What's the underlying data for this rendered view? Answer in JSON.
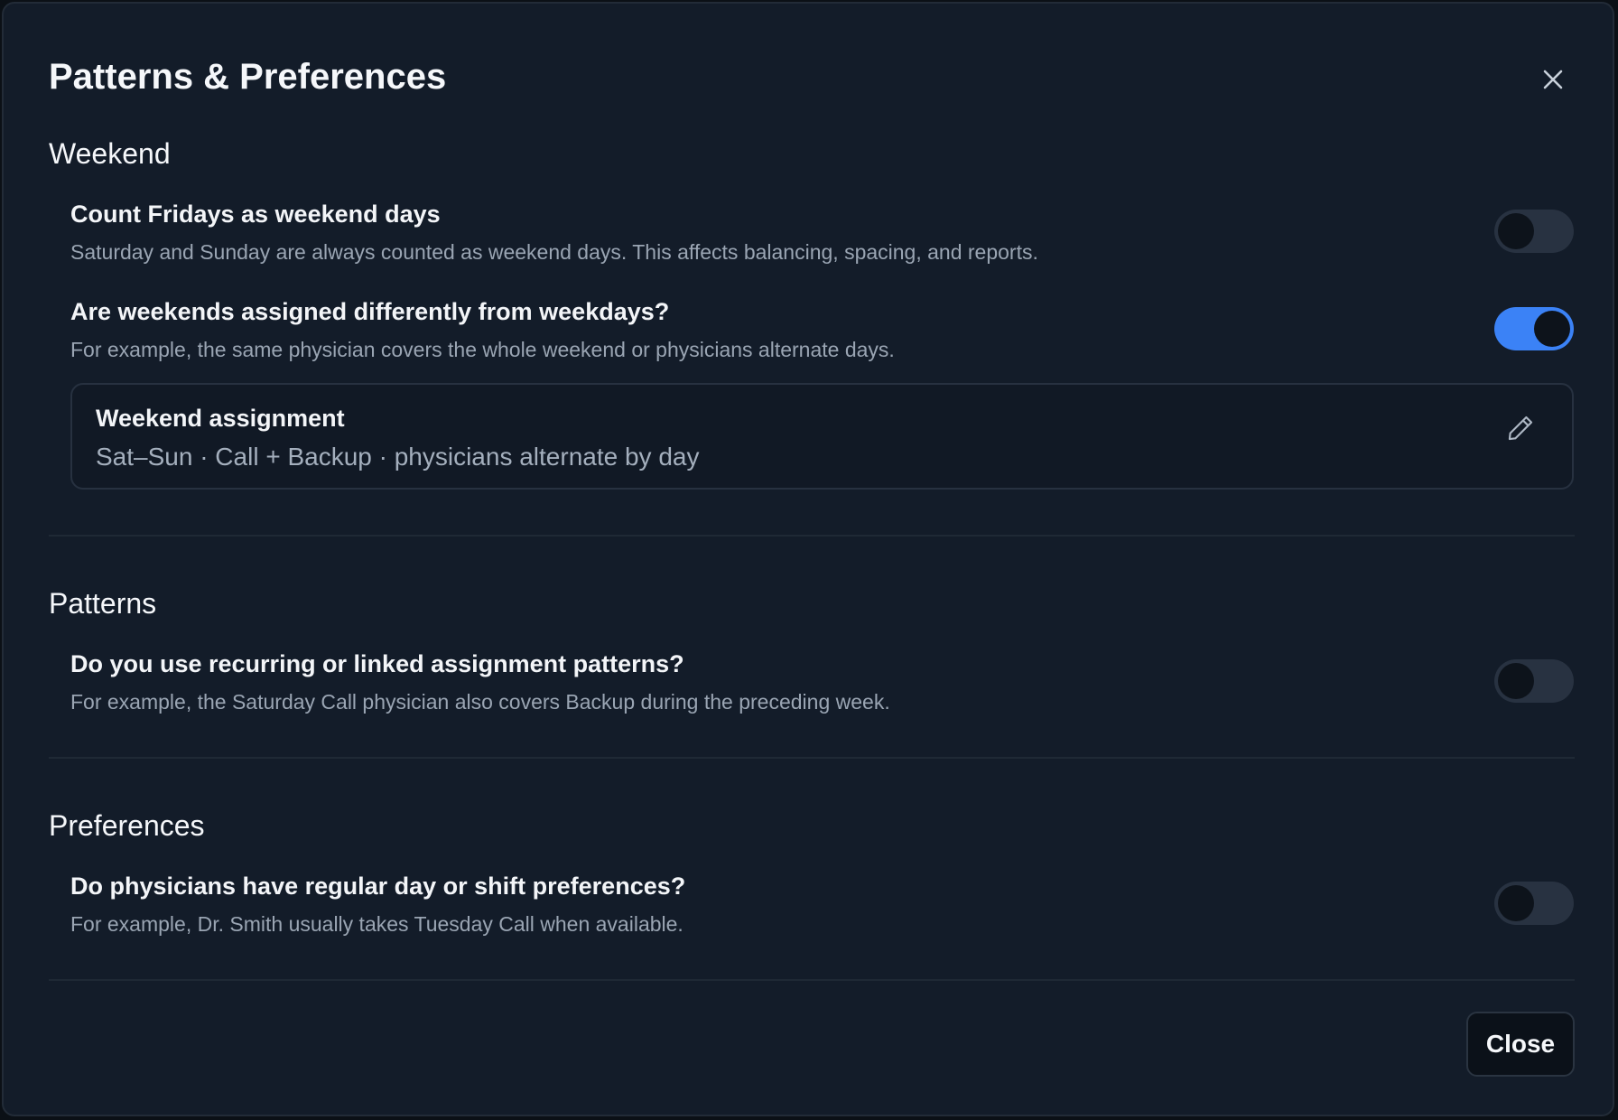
{
  "dialog": {
    "title": "Patterns & Preferences",
    "close_icon": "close-icon",
    "close_button_label": "Close"
  },
  "weekend": {
    "heading": "Weekend",
    "count_fridays": {
      "label": "Count Fridays as weekend days",
      "description": "Saturday and Sunday are always counted as weekend days. This affects balancing, spacing, and reports.",
      "enabled": false
    },
    "assigned_differently": {
      "label": "Are weekends assigned differently from weekdays?",
      "description": "For example, the same physician covers the whole weekend or physicians alternate days.",
      "enabled": true
    },
    "assignment_card": {
      "title": "Weekend assignment",
      "value": "Sat–Sun · Call + Backup · physicians alternate by day",
      "edit_icon": "pencil-icon"
    }
  },
  "patterns": {
    "heading": "Patterns",
    "recurring": {
      "label": "Do you use recurring or linked assignment patterns?",
      "description": "For example, the Saturday Call physician also covers Backup during the preceding week.",
      "enabled": false
    }
  },
  "preferences": {
    "heading": "Preferences",
    "regular": {
      "label": "Do physicians have regular day or shift preferences?",
      "description": "For example, Dr. Smith usually takes Tuesday Call when available.",
      "enabled": false
    }
  },
  "colors": {
    "background": "#131c29",
    "toggle_on": "#3b82f6",
    "toggle_off": "#283241",
    "text_primary": "#f3f5f8",
    "text_secondary": "#9aa5b3"
  }
}
